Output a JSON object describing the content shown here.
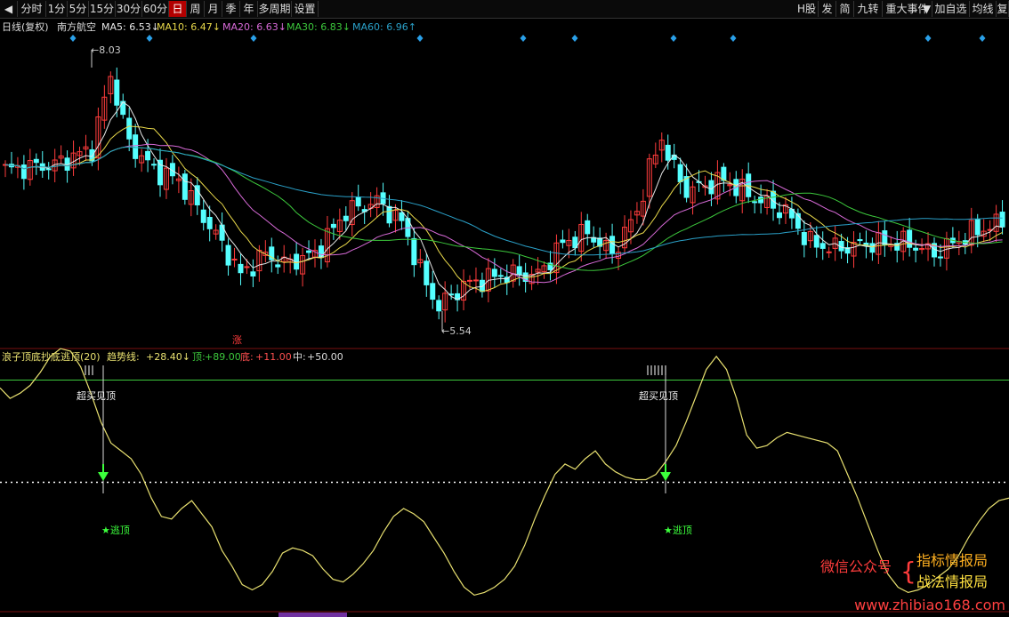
{
  "toolbar": {
    "back_glyph": "◀",
    "periods": [
      "分时",
      "1分",
      "5分",
      "15分",
      "30分",
      "60分",
      "日",
      "周",
      "月",
      "季",
      "年",
      "多周期",
      "设置"
    ],
    "active_period": "日",
    "right_buttons": [
      "H股",
      "发",
      "简",
      "九转",
      "重大事件",
      "加自选",
      "均线",
      "复"
    ]
  },
  "main_legend": {
    "period": "日线(复权)",
    "stock": "南方航空",
    "ma": [
      {
        "label": "MA5: 6.53",
        "arrow": "↓",
        "color": "#e8e8e8"
      },
      {
        "label": "MA10: 6.47",
        "arrow": "↓",
        "color": "#e8d84a"
      },
      {
        "label": "MA20: 6.63",
        "arrow": "↓",
        "color": "#d86ad8"
      },
      {
        "label": "MA30: 6.83",
        "arrow": "↓",
        "color": "#3cc83c"
      },
      {
        "label": "MA60: 6.96",
        "arrow": "↑",
        "color": "#2aa0c8"
      }
    ]
  },
  "price_markers": {
    "high": "8.03",
    "low": "5.54",
    "zhang": "涨"
  },
  "indicator_legend": {
    "name": "浪子顶底抄底逃顶(20)",
    "trend_label": "趋势线:",
    "trend_value": "+28.40",
    "trend_arrow": "↓",
    "top_label": "顶:",
    "top_value": "+89.00",
    "bottom_label": "底:",
    "bottom_value": "+11.00",
    "mid_label": "中:",
    "mid_value": "+50.00"
  },
  "signals": {
    "overbought": "超买见顶",
    "escape": "★逃顶"
  },
  "watermark": {
    "wechat": "微信公众号",
    "line1": "指标情报局",
    "line2": "战法情报局",
    "url": "www.zhibiao168.com"
  },
  "colors": {
    "up": "#ff3c3c",
    "down": "#55ffff",
    "trend": "#e8e070",
    "top_line": "#3cc83c",
    "accent_red": "#b20000"
  },
  "chart_data": {
    "type": "candlestick",
    "price_range": [
      5.54,
      8.03
    ],
    "indicator": {
      "type": "line",
      "name": "趋势线",
      "ylim": [
        0,
        100
      ],
      "levels": {
        "top": 89,
        "mid": 50,
        "bottom": 11
      },
      "values": [
        86,
        82,
        84,
        87,
        92,
        98,
        101,
        100,
        94,
        84,
        73,
        65,
        62,
        59,
        53,
        44,
        37,
        36,
        40,
        43,
        38,
        33,
        24,
        18,
        11,
        9,
        11,
        16,
        23,
        25,
        24,
        22,
        17,
        13,
        12,
        15,
        19,
        24,
        31,
        37,
        40,
        38,
        35,
        29,
        23,
        16,
        10,
        7,
        8,
        10,
        13,
        18,
        26,
        36,
        45,
        53,
        57,
        55,
        59,
        62,
        57,
        54,
        52,
        51,
        51,
        53,
        58,
        64,
        73,
        83,
        93,
        98,
        93,
        82,
        68,
        63,
        64,
        67,
        69,
        68,
        67,
        66,
        65,
        62,
        53,
        44,
        34,
        24,
        15,
        10,
        8,
        9,
        11,
        14,
        17,
        22,
        29,
        35,
        40,
        43,
        44
      ]
    }
  }
}
